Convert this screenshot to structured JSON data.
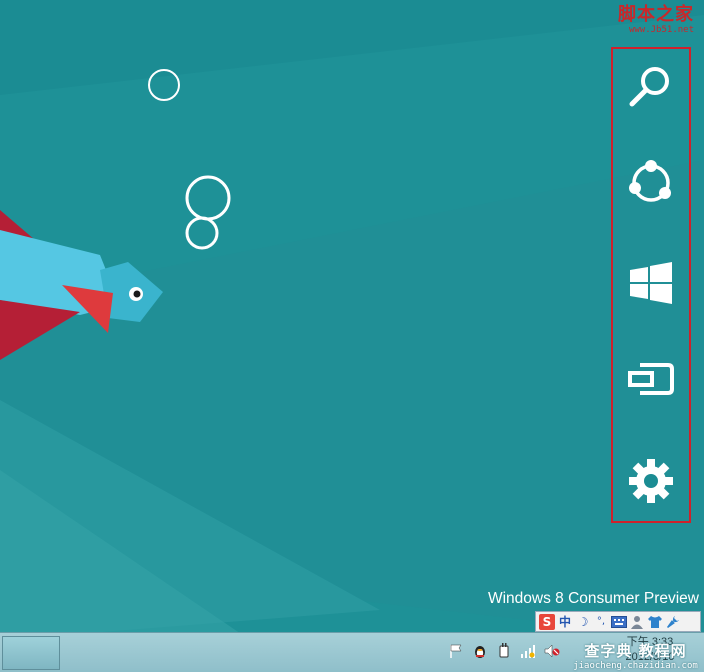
{
  "watermark_top": {
    "cn": "脚本之家",
    "url": "www.Jb51.net"
  },
  "background_text": "Windows 8 Consumer Preview",
  "charms": [
    {
      "name": "search",
      "icon": "search-icon"
    },
    {
      "name": "share",
      "icon": "share-icon"
    },
    {
      "name": "start",
      "icon": "windows-logo-icon"
    },
    {
      "name": "devices",
      "icon": "devices-icon"
    },
    {
      "name": "settings",
      "icon": "gear-icon"
    }
  ],
  "ime_bar": {
    "logo": "S",
    "mode": "中",
    "moon": "☽",
    "punct": "°,"
  },
  "clock": {
    "time": "下午 3:33",
    "date": "2012/3/10"
  },
  "watermark_bottom": {
    "big": "查字典 教程网",
    "small": "jiaocheng.chazidian.com"
  },
  "colors": {
    "background": "#1b8c93",
    "highlight_border": "#d0212b",
    "fish_body": "#55c7e3",
    "fish_fin": "#b51f36"
  }
}
